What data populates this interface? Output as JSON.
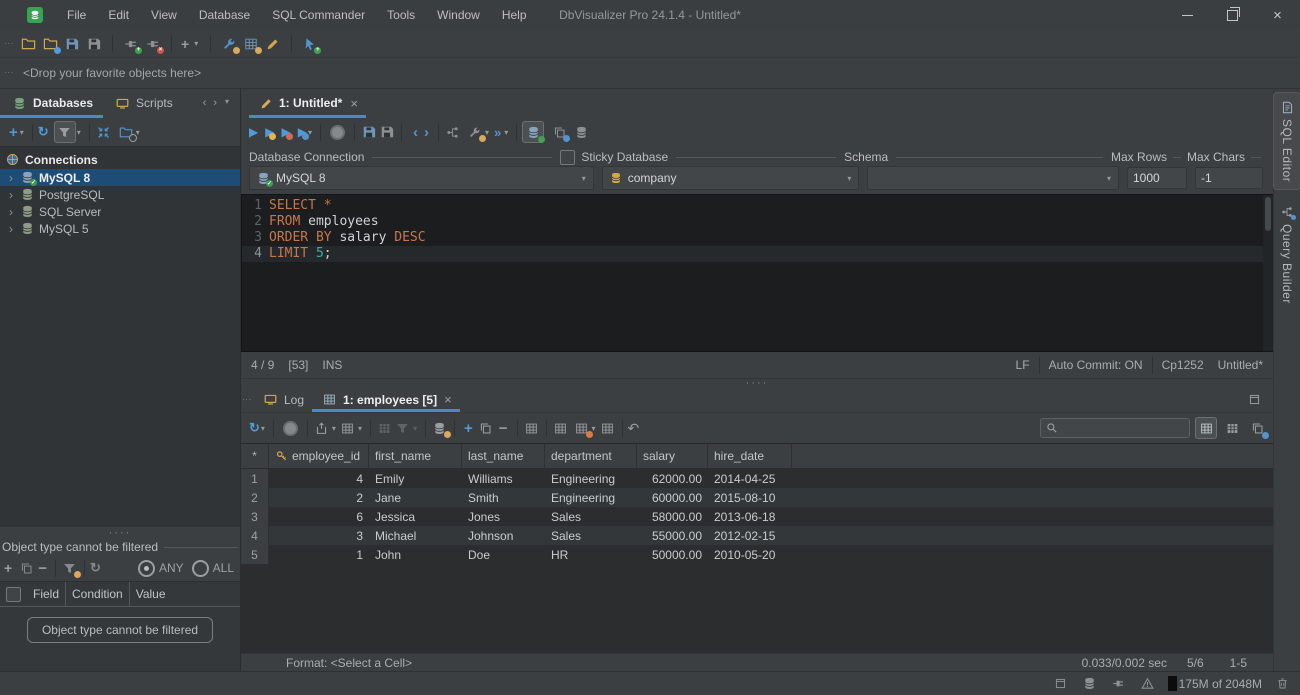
{
  "window": {
    "title": "DbVisualizer Pro 24.1.4 - Untitled*"
  },
  "menubar": {
    "items": [
      "File",
      "Edit",
      "View",
      "Database",
      "SQL Commander",
      "Tools",
      "Window",
      "Help"
    ]
  },
  "favorites_bar": {
    "placeholder": "<Drop your favorite objects here>"
  },
  "left_panel": {
    "tabs": {
      "databases": "Databases",
      "scripts": "Scripts"
    },
    "tree": {
      "root": "Connections",
      "items": [
        {
          "label": "MySQL 8",
          "selected": true,
          "connected": true
        },
        {
          "label": "PostgreSQL",
          "selected": false,
          "connected": false
        },
        {
          "label": "SQL Server",
          "selected": false,
          "connected": false
        },
        {
          "label": "MySQL 5",
          "selected": false,
          "connected": false
        }
      ]
    },
    "filter": {
      "title": "Object type cannot be filtered",
      "any_label": "ANY",
      "all_label": "ALL",
      "columns": [
        "Field",
        "Condition",
        "Value"
      ],
      "button_label": "Object type cannot be filtered"
    }
  },
  "editor": {
    "tab_label": "1: Untitled*",
    "connection_bar": {
      "connection_label": "Database Connection",
      "connection_value": "MySQL 8",
      "sticky_label": "Sticky Database",
      "database_value": "company",
      "schema_label": "Schema",
      "schema_value": "",
      "max_rows_label": "Max Rows",
      "max_rows_value": "1000",
      "max_chars_label": "Max Chars",
      "max_chars_value": "-1"
    },
    "code_lines": [
      {
        "num": "1",
        "current": false,
        "segments": [
          {
            "text": "SELECT",
            "type": "keyword"
          },
          {
            "text": " *",
            "type": "keyword"
          }
        ]
      },
      {
        "num": "2",
        "current": false,
        "segments": [
          {
            "text": "FROM",
            "type": "keyword"
          },
          {
            "text": " employees",
            "type": "plain"
          }
        ]
      },
      {
        "num": "3",
        "current": false,
        "segments": [
          {
            "text": "ORDER BY",
            "type": "keyword"
          },
          {
            "text": " salary ",
            "type": "plain"
          },
          {
            "text": "DESC",
            "type": "keyword"
          }
        ]
      },
      {
        "num": "4",
        "current": true,
        "segments": [
          {
            "text": "LIMIT",
            "type": "keyword"
          },
          {
            "text": " ",
            "type": "plain"
          },
          {
            "text": "5",
            "type": "number"
          },
          {
            "text": ";",
            "type": "plain"
          }
        ]
      }
    ],
    "status": {
      "caret": "4 / 9",
      "sel": "[53]",
      "mode": "INS",
      "eol": "LF",
      "auto_commit": "Auto Commit: ON",
      "encoding": "Cp1252",
      "doc": "Untitled*"
    }
  },
  "results": {
    "log_tab": "Log",
    "grid_tab": "1: employees [5]",
    "grid": {
      "corner": "*",
      "columns": [
        "employee_id",
        "first_name",
        "last_name",
        "department",
        "salary",
        "hire_date"
      ],
      "rows": [
        [
          "4",
          "Emily",
          "Williams",
          "Engineering",
          "62000.00",
          "2014-04-25"
        ],
        [
          "2",
          "Jane",
          "Smith",
          "Engineering",
          "60000.00",
          "2015-08-10"
        ],
        [
          "6",
          "Jessica",
          "Jones",
          "Sales",
          "58000.00",
          "2013-06-18"
        ],
        [
          "3",
          "Michael",
          "Johnson",
          "Sales",
          "55000.00",
          "2012-02-15"
        ],
        [
          "1",
          "John",
          "Doe",
          "HR",
          "50000.00",
          "2010-05-20"
        ]
      ]
    },
    "status": {
      "format": "Format: <Select a Cell>",
      "time": "0.033/0.002 sec",
      "rows_info": "5/6",
      "range": "1-5"
    }
  },
  "right_strip": {
    "sql_editor": "SQL Editor",
    "query_builder": "Query Builder"
  },
  "app_status": {
    "memory": "175M of 2048M"
  },
  "colors": {
    "accent_blue": "#4a88c7",
    "selection_blue": "#1d4d77",
    "keyword_orange": "#c9764a",
    "number_teal": "#2fb3ab",
    "logo_green": "#36a452"
  },
  "icons": {
    "app-logo-icon": "green database logo",
    "search-icon": "magnifier",
    "filter-icon": "funnel",
    "refresh-icon": "circular arrows",
    "run-icon": "blue play triangle",
    "stop-icon": "gray circle",
    "save-icon": "floppy disk",
    "database-icon": "cylinder",
    "key-icon": "primary key",
    "warning-icon": "triangle",
    "trash-icon": "garbage can",
    "maximize-panel-icon": "square",
    "close-icon": "x",
    "chevron-down-icon": "small down arrow",
    "splitter-grip-icon": "drag dots"
  }
}
